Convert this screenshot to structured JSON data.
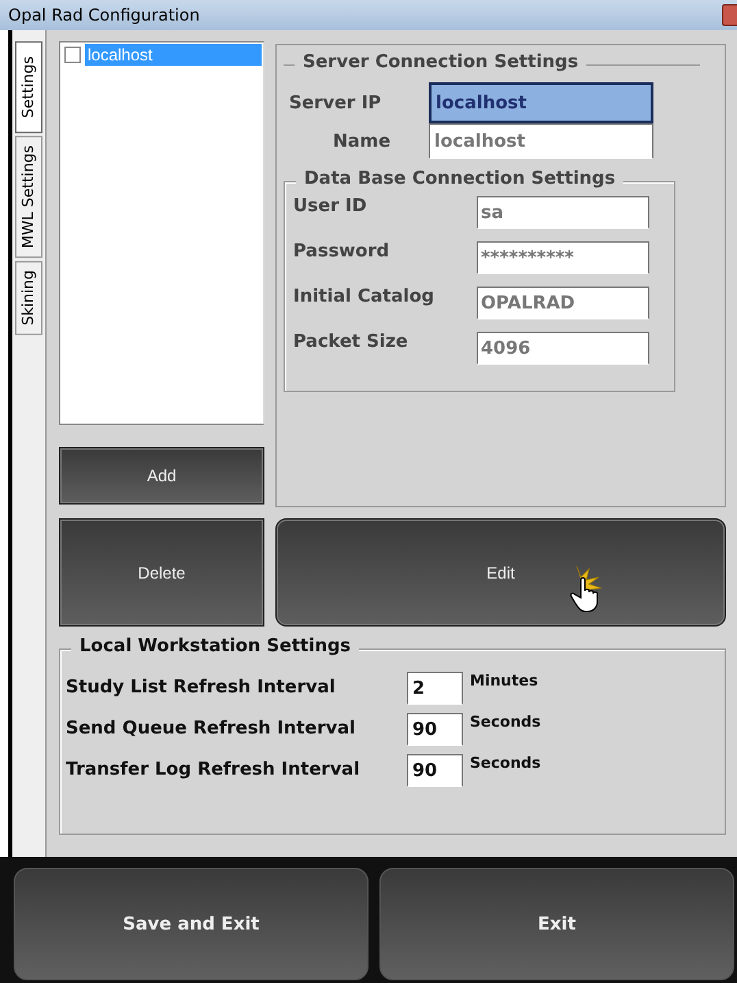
{
  "window": {
    "title": "Opal Rad Configuration"
  },
  "tabs": [
    {
      "label": "Settings",
      "selected": true
    },
    {
      "label": "MWL Settings",
      "selected": false
    },
    {
      "label": "Skining",
      "selected": false
    }
  ],
  "server_list": [
    {
      "label": "localhost",
      "checked": false,
      "selected": true
    }
  ],
  "add_button": "Add",
  "server_connection": {
    "title": "Server Connection Settings",
    "fields": [
      {
        "label": "Server IP",
        "value": "localhost",
        "focused": true
      },
      {
        "label": "Name",
        "value": "localhost",
        "focused": false
      }
    ]
  },
  "database_connection": {
    "title": "Data Base Connection Settings",
    "fields": [
      {
        "label": "User ID",
        "value": "sa"
      },
      {
        "label": "Password",
        "value": "**********"
      },
      {
        "label": "Initial Catalog",
        "value": "OPALRAD"
      },
      {
        "label": "Packet Size",
        "value": "4096"
      }
    ]
  },
  "delete_button": "Delete",
  "edit_button": "Edit",
  "local_workstation": {
    "title": "Local Workstation Settings",
    "rows": [
      {
        "label": "Study List Refresh Interval",
        "value": "2",
        "unit": "Minutes"
      },
      {
        "label": "Send Queue Refresh Interval",
        "value": "90",
        "unit": "Seconds"
      },
      {
        "label": "Transfer Log Refresh Interval",
        "value": "90",
        "unit": "Seconds"
      }
    ]
  },
  "footer_buttons": [
    {
      "label": "Save and Exit"
    },
    {
      "label": "Exit"
    }
  ]
}
